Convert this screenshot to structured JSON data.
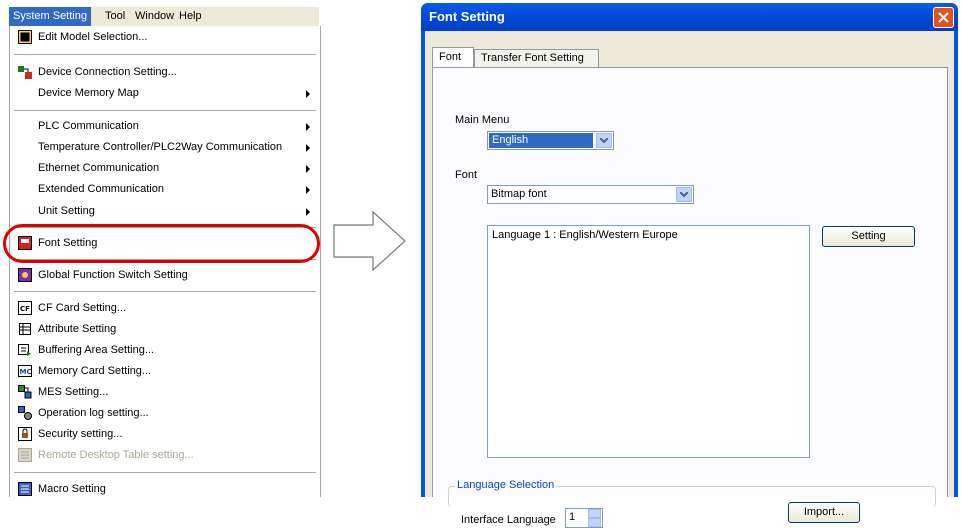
{
  "menubar": {
    "items": [
      "System Setting",
      "Tool",
      "Window",
      "Help"
    ]
  },
  "menu": {
    "edit_model": "Edit Model Selection...",
    "device_connection": "Device Connection Setting...",
    "device_memory_map": "Device Memory Map",
    "plc_comm": "PLC Communication",
    "temp_controller": "Temperature Controller/PLC2Way Communication",
    "ethernet": "Ethernet Communication",
    "extended": "Extended Communication",
    "unit_setting": "Unit Setting",
    "font_setting": "Font Setting",
    "global_function": "Global Function Switch Setting",
    "cf_card": "CF Card Setting...",
    "attribute": "Attribute Setting",
    "buffering": "Buffering Area Setting...",
    "memory_card": "Memory Card Setting...",
    "mes": "MES Setting...",
    "operation_log": "Operation log setting...",
    "security": "Security setting...",
    "remote_desktop": "Remote Desktop Table setting...",
    "macro": "Macro Setting"
  },
  "dialog": {
    "title": "Font Setting",
    "tabs": [
      "Font",
      "Transfer Font Setting"
    ],
    "main_menu_label": "Main Menu",
    "main_menu_value": "English",
    "font_label": "Font",
    "font_value": "Bitmap font",
    "language_list": [
      "Language 1 : English/Western Europe"
    ],
    "setting_button": "Setting",
    "language_selection_label": "Language Selection",
    "interface_language_label": "Interface Language",
    "interface_language_value": "1",
    "import_button": "Import..."
  },
  "colors": {
    "highlight": "#e00000",
    "menu_active": "#316ac5",
    "titlebar": "#0046d5"
  }
}
